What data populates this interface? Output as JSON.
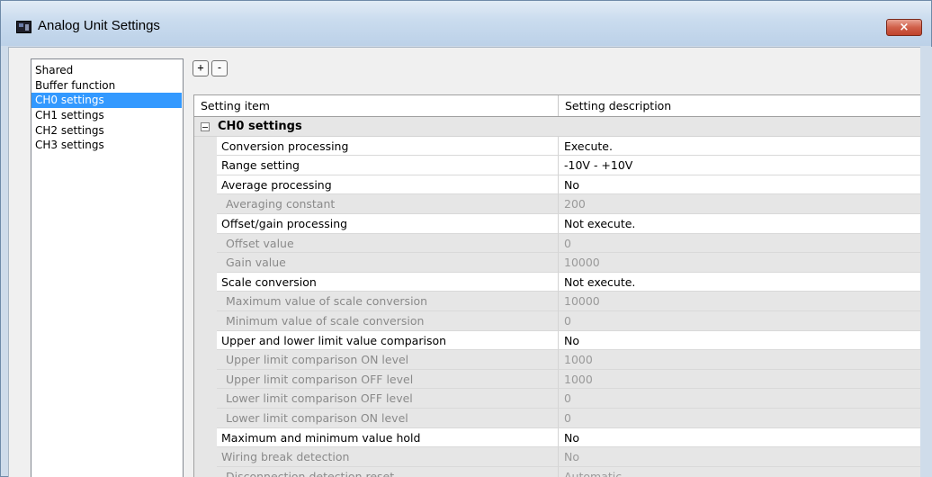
{
  "window": {
    "title": "Analog Unit Settings",
    "close_label": "×"
  },
  "tree": {
    "items": [
      {
        "label": "Shared"
      },
      {
        "label": "Buffer function"
      },
      {
        "label": "CH0 settings",
        "selected": true
      },
      {
        "label": "CH1 settings"
      },
      {
        "label": "CH2 settings"
      },
      {
        "label": "CH3 settings"
      }
    ]
  },
  "toolbar": {
    "expand_label": "+",
    "collapse_label": "-"
  },
  "grid": {
    "header": {
      "item": "Setting item",
      "description": "Setting description"
    },
    "group": "CH0 settings",
    "rows": [
      {
        "name": "Conversion processing",
        "value": "Execute.",
        "enabled": true
      },
      {
        "name": "Range setting",
        "value": "-10V - +10V",
        "enabled": true
      },
      {
        "name": "Average processing",
        "value": "No",
        "enabled": true
      },
      {
        "name": "Averaging constant",
        "value": "200",
        "enabled": false
      },
      {
        "name": "Offset/gain processing",
        "value": "Not execute.",
        "enabled": true
      },
      {
        "name": "Offset value",
        "value": "0",
        "enabled": false
      },
      {
        "name": "Gain value",
        "value": "10000",
        "enabled": false
      },
      {
        "name": "Scale conversion",
        "value": "Not execute.",
        "enabled": true
      },
      {
        "name": "Maximum value of scale conversion",
        "value": "10000",
        "enabled": false
      },
      {
        "name": "Minimum value of scale conversion",
        "value": "0",
        "enabled": false
      },
      {
        "name": "Upper and lower limit value comparison",
        "value": "No",
        "enabled": true
      },
      {
        "name": "Upper limit comparison ON level",
        "value": "1000",
        "enabled": false
      },
      {
        "name": "Upper limit comparison OFF level",
        "value": "1000",
        "enabled": false
      },
      {
        "name": "Lower limit comparison OFF level",
        "value": "0",
        "enabled": false
      },
      {
        "name": "Lower limit comparison ON level",
        "value": "0",
        "enabled": false
      },
      {
        "name": "Maximum and minimum value hold",
        "value": "No",
        "enabled": true
      },
      {
        "name": "Wiring break detection",
        "value": "No",
        "enabled": false,
        "top_level": true
      },
      {
        "name": "Disconnection detection reset",
        "value": "Automatic",
        "enabled": false
      }
    ]
  },
  "colors": {
    "selection": "#3399ff",
    "disabled_bg": "#e6e6e6",
    "close_button": "#c0432c"
  }
}
